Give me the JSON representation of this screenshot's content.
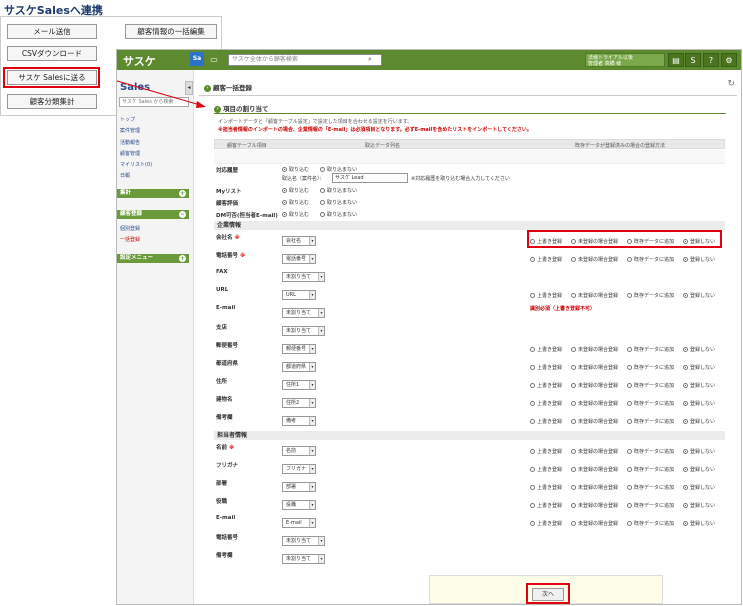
{
  "heading": "サスケSalesへ連携",
  "outer_buttons": {
    "mail": "メール送信",
    "bulk_edit": "顧客情報の一括編集",
    "csv": "CSVダウンロード",
    "send_sales": "サスケ Salesに送る",
    "category": "顧客分類集計"
  },
  "topbar": {
    "logo": "サスケ",
    "badge": "Sa",
    "search_placeholder": "サスケ全体から顧客検索",
    "user_line1": "法様トライアル以後",
    "user_line2": "管理者 高橋 様",
    "help": "?",
    "settings": "⚙"
  },
  "sidebar": {
    "logo": "Sales",
    "search_placeholder": "サスケ Sales から検索",
    "items": [
      "トップ",
      "案件管理",
      "活動報告",
      "顧客管理",
      "マイリスト(0)",
      "日報"
    ],
    "sec_stats": "集計",
    "sec_register": "顧客登録",
    "reg_items": [
      "個別登録",
      "一括登録"
    ],
    "sec_settings": "設定メニュー"
  },
  "main": {
    "page_title": "顧客一括登録",
    "section_title": "項目の割り当て",
    "desc1": "インポートデータと「顧客テーブル設定」で設定した項目を合わせる設定を行います。",
    "desc2": "※担当者情報のインポートの場合、企業情報の「E-mail」は必須項目となります。必ずE-mailを含めたリストをインポートしてください。",
    "col_headers": [
      "顧客テーブル項目",
      "取込データ列名",
      "既存データが登録済みの場合の登録方法"
    ],
    "opt_import": "取り込む",
    "opt_no_import": "取り込まない",
    "label_taiou": "対応履歴",
    "taiou_sub_label": "取込名（案件名）：",
    "taiou_input": "サスケ Lead",
    "taiou_note": "※対応履歴を取り込む場合入力してください",
    "label_mylist": "Myリスト",
    "label_eval": "顧客評価",
    "label_dm": "DM可否(担当者E-mail)",
    "group_company": "企業情報",
    "group_person": "担当者情報",
    "mode_overwrite": "上書き登録",
    "mode_unregistered": "未登録の場合登録",
    "mode_append": "既存データに追加",
    "mode_skip": "登録しない",
    "email_note": "識別必須（上書き登録不可）",
    "next_button": "次へ",
    "company_rows": [
      {
        "label": "会社名",
        "req": "※",
        "select": "会社名",
        "modes": true
      },
      {
        "label": "電話番号",
        "req": "※",
        "select": "電話番号",
        "modes": true
      },
      {
        "label": "FAX",
        "req": "",
        "select": "未割り当て",
        "modes": false
      },
      {
        "label": "URL",
        "req": "",
        "select": "URL",
        "modes": true
      },
      {
        "label": "E-mail",
        "req": "",
        "select": "未割り当て",
        "modes": false,
        "note": true
      },
      {
        "label": "支店",
        "req": "",
        "select": "未割り当て",
        "modes": false
      },
      {
        "label": "郵便番号",
        "req": "",
        "select": "郵便番号",
        "modes": true
      },
      {
        "label": "都道府県",
        "req": "",
        "select": "都道府県",
        "modes": true
      },
      {
        "label": "住所",
        "req": "",
        "select": "住所1",
        "modes": true
      },
      {
        "label": "建物名",
        "req": "",
        "select": "住所2",
        "modes": true
      },
      {
        "label": "備考欄",
        "req": "",
        "select": "備考",
        "modes": true
      }
    ],
    "person_rows": [
      {
        "label": "名前",
        "req": "※",
        "select": "名前",
        "modes": true
      },
      {
        "label": "フリガナ",
        "req": "",
        "select": "フリガナ",
        "modes": true
      },
      {
        "label": "部署",
        "req": "",
        "select": "部署",
        "modes": true
      },
      {
        "label": "役職",
        "req": "",
        "select": "役職",
        "modes": true
      },
      {
        "label": "E-mail",
        "req": "",
        "select": "E-mail",
        "modes": true
      },
      {
        "label": "電話番号",
        "req": "",
        "select": "未割り当て",
        "modes": false
      },
      {
        "label": "備考欄",
        "req": "",
        "select": "未割り当て",
        "modes": false
      }
    ]
  }
}
